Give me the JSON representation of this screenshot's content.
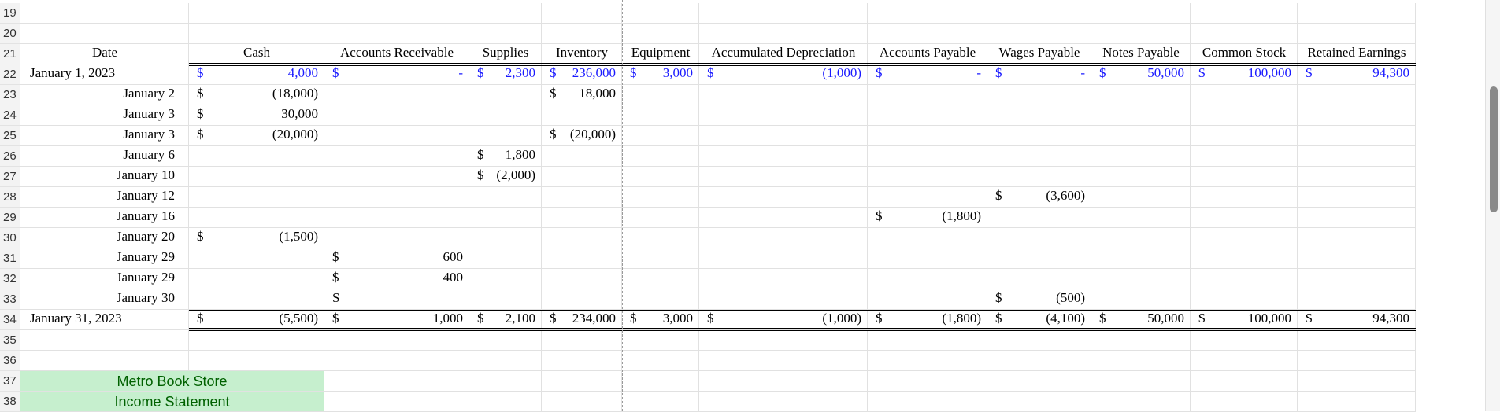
{
  "rows": [
    "19",
    "20",
    "21",
    "22",
    "23",
    "24",
    "25",
    "26",
    "27",
    "28",
    "29",
    "30",
    "31",
    "32",
    "33",
    "34",
    "35",
    "36",
    "37",
    "38"
  ],
  "headers": {
    "date": "Date",
    "cash": "Cash",
    "ar": "Accounts Receivable",
    "supplies": "Supplies",
    "inventory": "Inventory",
    "equipment": "Equipment",
    "accdep": "Accumulated Depreciation",
    "ap": "Accounts Payable",
    "wages": "Wages Payable",
    "notes": "Notes Payable",
    "cs": "Common Stock",
    "re": "Retained Earnings"
  },
  "opening": {
    "date": "January 1, 2023",
    "cash": "4,000",
    "ar": "-",
    "supplies": "2,300",
    "inventory": "236,000",
    "equipment": "3,000",
    "accdep": "(1,000)",
    "ap": "-",
    "wages": "-",
    "notes": "50,000",
    "cs": "100,000",
    "re": "94,300"
  },
  "transactions": [
    {
      "date": "January 2",
      "cash": "(18,000)",
      "inventory": "18,000"
    },
    {
      "date": "January 3",
      "cash": "30,000"
    },
    {
      "date": "January 3",
      "cash": "(20,000)",
      "inventory": "(20,000)"
    },
    {
      "date": "January 6",
      "supplies": "1,800"
    },
    {
      "date": "January 10",
      "supplies": "(2,000)"
    },
    {
      "date": "January 12",
      "wages": "(3,600)"
    },
    {
      "date": "January 16",
      "ap": "(1,800)"
    },
    {
      "date": "January 20",
      "cash": "(1,500)"
    },
    {
      "date": "January 29",
      "ar": "600"
    },
    {
      "date": "January 29",
      "ar": "400"
    },
    {
      "date": "January 30",
      "ar_sym": "S",
      "wages": "(500)"
    }
  ],
  "closing": {
    "date": "January 31, 2023",
    "cash": "(5,500)",
    "ar": "1,000",
    "supplies": "2,100",
    "inventory": "234,000",
    "equipment": "3,000",
    "accdep": "(1,000)",
    "ap": "(1,800)",
    "wages": "(4,100)",
    "notes": "50,000",
    "cs": "100,000",
    "re": "94,300"
  },
  "income_statement": {
    "company": "Metro Book Store",
    "title": "Income Statement"
  },
  "currency": "$",
  "colors": {
    "input_blue": "#1a1aff",
    "green_fill": "#c6efce",
    "green_text": "#006100"
  }
}
